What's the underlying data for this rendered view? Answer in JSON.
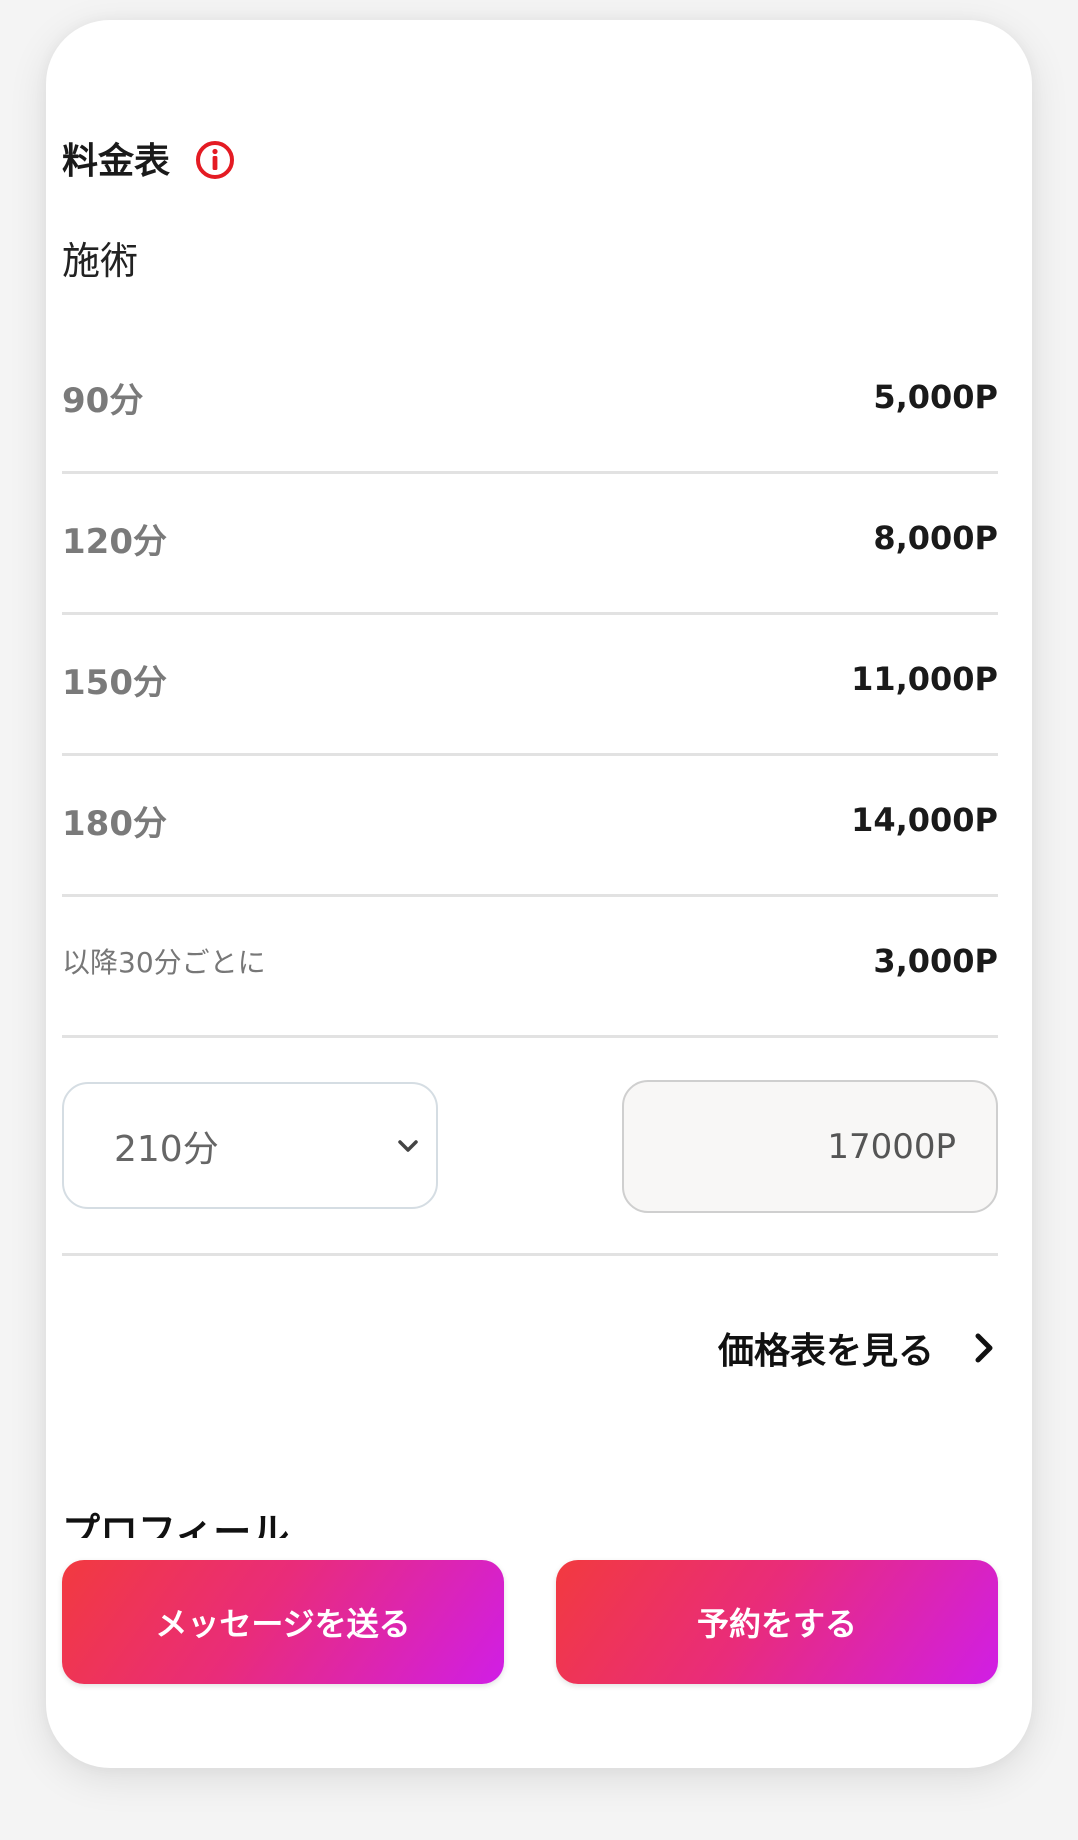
{
  "pricing": {
    "title": "料金表",
    "info_icon": "info-circle-icon",
    "accent_color": "#e41b23",
    "subtitle": "施術",
    "rows": [
      {
        "label": "90分",
        "value": "5,000P"
      },
      {
        "label": "120分",
        "value": "8,000P"
      },
      {
        "label": "150分",
        "value": "11,000P"
      },
      {
        "label": "180分",
        "value": "14,000P"
      },
      {
        "label": "以降30分ごとに",
        "value": "3,000P"
      }
    ],
    "duration_select": {
      "selected": "210分"
    },
    "total": "17000P",
    "view_table_link": "価格表を見る"
  },
  "profile": {
    "title": "プロフィール"
  },
  "actions": {
    "message_label": "メッセージを送る",
    "reserve_label": "予約をする",
    "gradient_start": "#f23a3f",
    "gradient_end": "#d01ee6"
  }
}
